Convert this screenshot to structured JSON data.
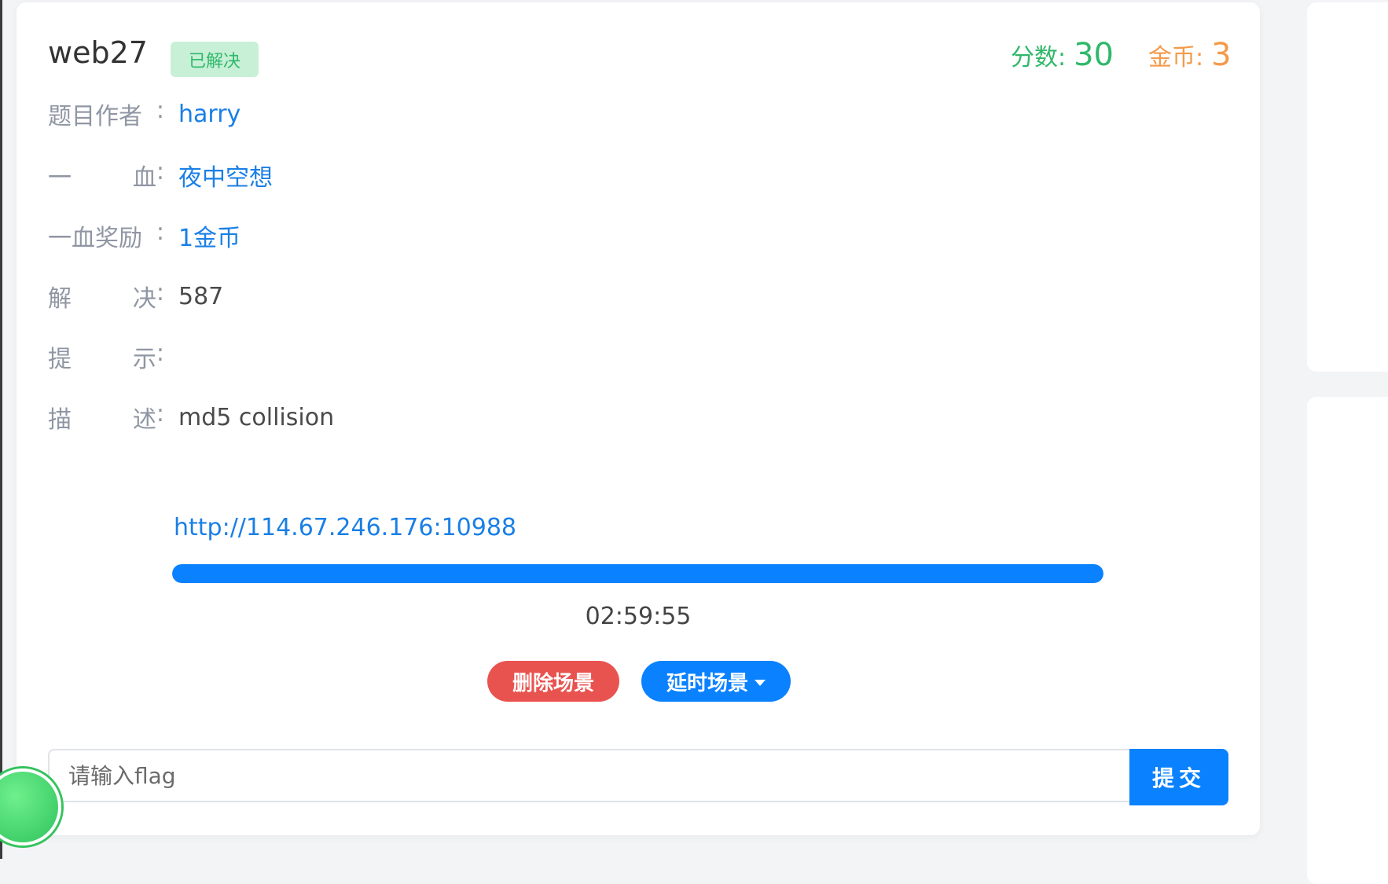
{
  "challenge": {
    "title": "web27",
    "status_badge": "已解决",
    "score_label": "分数:",
    "score_value": "30",
    "coins_label": "金币:",
    "coins_value": "3"
  },
  "details": {
    "author_label_chars": [
      "题",
      "目",
      "作",
      "者"
    ],
    "author_colon": ":",
    "author_value": "harry",
    "first_blood_label_chars": [
      "一",
      "血"
    ],
    "first_blood_value": "夜中空想",
    "first_blood_reward_label_chars": [
      "一",
      "血",
      "奖",
      "励"
    ],
    "first_blood_reward_value": "1金币",
    "solves_label_chars": [
      "解",
      "决"
    ],
    "solves_value": "587",
    "hint_label_chars": [
      "提",
      "示"
    ],
    "hint_value": "",
    "description_label_chars": [
      "描",
      "述"
    ],
    "description_value": "md5 collision"
  },
  "instance": {
    "url": "http://114.67.246.176:10988",
    "progress_fraction": 1.0,
    "timer": "02:59:55",
    "delete_button": "删除场景",
    "delay_button": "延时场景"
  },
  "flag_form": {
    "placeholder": "请输入flag",
    "value": "",
    "submit_label": "提交"
  },
  "colors": {
    "accent_blue": "#0a82ff",
    "danger_red": "#e9534f",
    "success_green": "#2fb86a",
    "coin_orange": "#f39a4a"
  }
}
